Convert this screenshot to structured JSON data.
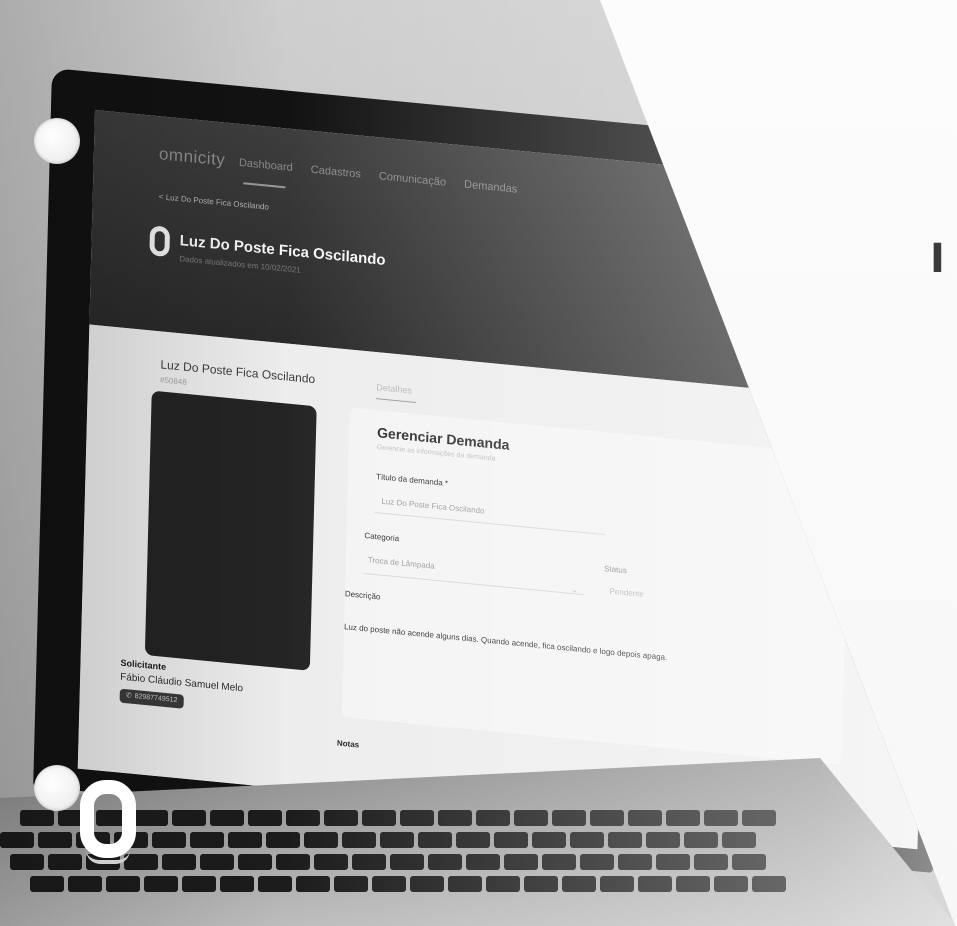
{
  "app": {
    "logo": "omnicity",
    "nav": [
      "Dashboard",
      "Cadastros",
      "Comunicação",
      "Demandas"
    ]
  },
  "breadcrumb": "< Luz Do Poste Fica Oscilando",
  "header": {
    "title": "Luz Do Poste Fica Oscilando",
    "subtitle": "Dados atualizados em 10/02/2021"
  },
  "left_card": {
    "title": "Luz Do Poste Fica Oscilando",
    "id": "#50848",
    "requester_label": "Solicitante",
    "requester_name": "Fábio Cláudio Samuel Melo",
    "phone": "82987749512"
  },
  "tabs": {
    "detalhes": "Detalhes"
  },
  "form": {
    "title": "Gerenciar Demanda",
    "subtitle": "Gerencie as informações da demanda",
    "titulo_label": "Título da demanda *",
    "titulo_value": "Luz Do Poste Fica Oscilando",
    "categoria_label": "Categoria",
    "categoria_value": "Troca de Lâmpada",
    "status_label": "Status",
    "status_value": "Pendente",
    "descricao_label": "Descrição",
    "descricao_value": "Luz do poste não acende alguns dias. Quando acende, fica oscilando e logo depois apaga.",
    "notas_label": "Notas"
  },
  "side_text": "I"
}
